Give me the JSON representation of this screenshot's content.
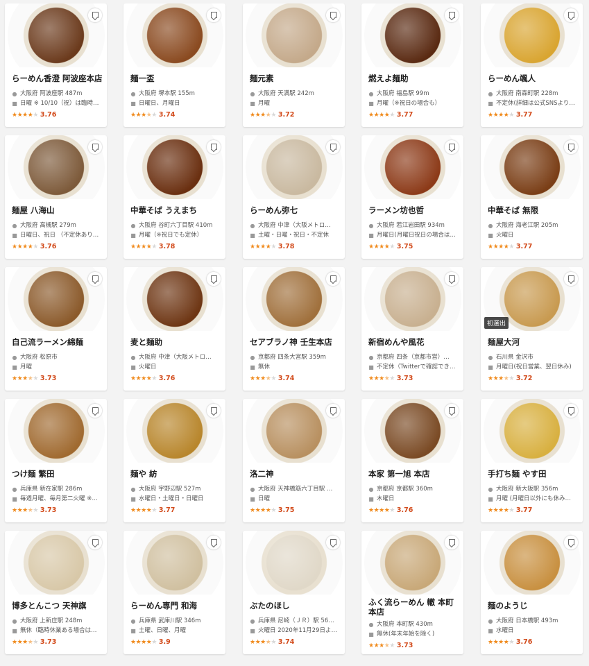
{
  "shops": [
    {
      "name": "らーめん香澄 阿波座本店",
      "location": "大阪府 阿波座駅 487m",
      "closed": "日曜 ※ 10/10（祝）は臨時…",
      "score": "3.76",
      "stars": 3.76,
      "photo": "#6b3a1c"
    },
    {
      "name": "麺一盃",
      "location": "大阪府 堺本駅 155m",
      "closed": "日曜日、月曜日",
      "score": "3.74",
      "stars": 3.74,
      "photo": "#8a4a20"
    },
    {
      "name": "麺元素",
      "location": "大阪府 天満駅 242m",
      "closed": "月曜",
      "score": "3.72",
      "stars": 3.72,
      "photo": "#c4a98a"
    },
    {
      "name": "燃えよ麺助",
      "location": "大阪府 福島駅 99m",
      "closed": "月曜（※祝日の場合も）",
      "score": "3.77",
      "stars": 3.77,
      "photo": "#5a2a12"
    },
    {
      "name": "らーめん颯人",
      "location": "大阪府 南森町駅 228m",
      "closed": "不定休(詳細は公式SNSより…",
      "score": "3.77",
      "stars": 3.77,
      "photo": "#d9a531"
    },
    {
      "name": "麺屋 八海山",
      "location": "大阪府 高槻駅 279m",
      "closed": "日曜日、祝日 （不定休あり…",
      "score": "3.76",
      "stars": 3.76,
      "photo": "#7d5a3a"
    },
    {
      "name": "中華そば うえまち",
      "location": "大阪府 谷町六丁目駅 410m",
      "closed": "月曜（※祝日でも定休）",
      "score": "3.78",
      "stars": 3.78,
      "photo": "#6a2f10"
    },
    {
      "name": "らーめん弥七",
      "location": "大阪府 中津（大阪メトロ…",
      "closed": "土曜・日曜・祝日・不定休",
      "score": "3.78",
      "stars": 3.78,
      "photo": "#c9b9a0"
    },
    {
      "name": "ラーメン坊也哲",
      "location": "大阪府 若江岩田駅 934m",
      "closed": "月曜日(月曜日祝日の場合は…",
      "score": "3.75",
      "stars": 3.75,
      "photo": "#8c3a18"
    },
    {
      "name": "中華そば 無限",
      "location": "大阪府 海老江駅 205m",
      "closed": "火曜日",
      "score": "3.77",
      "stars": 3.77,
      "photo": "#7a3e16"
    },
    {
      "name": "自己流ラーメン綿麺",
      "location": "大阪府 松原市",
      "closed": "月曜",
      "score": "3.73",
      "stars": 3.73,
      "photo": "#8b5a2b"
    },
    {
      "name": "麦と麺助",
      "location": "大阪府 中津（大阪メトロ…",
      "closed": "火曜日",
      "score": "3.76",
      "stars": 3.76,
      "photo": "#6e3614"
    },
    {
      "name": "セアブラノ神 壬生本店",
      "location": "京都府 四条大宮駅 359m",
      "closed": "無休",
      "score": "3.74",
      "stars": 3.74,
      "photo": "#a0703c"
    },
    {
      "name": "新宿めんや風花",
      "location": "京都府 四条（京都市営）…",
      "closed": "不定休（Twitterで確認できま…",
      "score": "3.73",
      "stars": 3.73,
      "photo": "#c8b090"
    },
    {
      "name": "麺屋大河",
      "location": "石川県 金沢市",
      "closed": "月曜日(祝日営業、翌日休み)",
      "score": "3.72",
      "stars": 3.72,
      "photo": "#c89a50",
      "badge": "初選出"
    },
    {
      "name": "つけ麺 繁田",
      "location": "兵庫県 新在家駅 286m",
      "closed": "毎週月曜、毎月第二火曜 ※…",
      "score": "3.73",
      "stars": 3.73,
      "photo": "#a06a30"
    },
    {
      "name": "麺や 紡",
      "location": "大阪府 宇野辺駅 527m",
      "closed": "水曜日・土曜日・日曜日",
      "score": "3.77",
      "stars": 3.77,
      "photo": "#b8862c"
    },
    {
      "name": "洛二神",
      "location": "大阪府 天神橋筋六丁目駅 …",
      "closed": "日曜",
      "score": "3.75",
      "stars": 3.75,
      "photo": "#b89060"
    },
    {
      "name": "本家 第一旭 本店",
      "location": "京都府 京都駅 360m",
      "closed": "木曜日",
      "score": "3.76",
      "stars": 3.76,
      "photo": "#7a4a24"
    },
    {
      "name": "手打ち麺 やす田",
      "location": "大阪府 新大阪駅 356m",
      "closed": "月曜 (月曜日以外にも休み…",
      "score": "3.77",
      "stars": 3.77,
      "photo": "#d8b040"
    },
    {
      "name": "博多とんこつ 天神旗",
      "location": "大阪府 上新庄駅 248m",
      "closed": "無休（臨時休業ある場合は…",
      "score": "3.73",
      "stars": 3.73,
      "photo": "#d8c8a8"
    },
    {
      "name": "らーめん専門 和海",
      "location": "兵庫県 武庫川駅 346m",
      "closed": "土曜、日曜、月曜",
      "score": "3.9",
      "stars": 3.9,
      "photo": "#d0c0a0"
    },
    {
      "name": "ぶたのほし",
      "location": "兵庫県 尼崎（ＪＲ）駅 56…",
      "closed": "火曜日 2020年11月29日よ…",
      "score": "3.74",
      "stars": 3.74,
      "photo": "#e0d8c8"
    },
    {
      "name": "ふく流らーめん 轍 本町本店",
      "location": "大阪府 本町駅 430m",
      "closed": "無休(年末年始を除く)",
      "score": "3.73",
      "stars": 3.73,
      "photo": "#c8a878"
    },
    {
      "name": "麺のようじ",
      "location": "大阪府 日本橋駅 493m",
      "closed": "水曜日",
      "score": "3.76",
      "stars": 3.76,
      "photo": "#c89040"
    }
  ]
}
